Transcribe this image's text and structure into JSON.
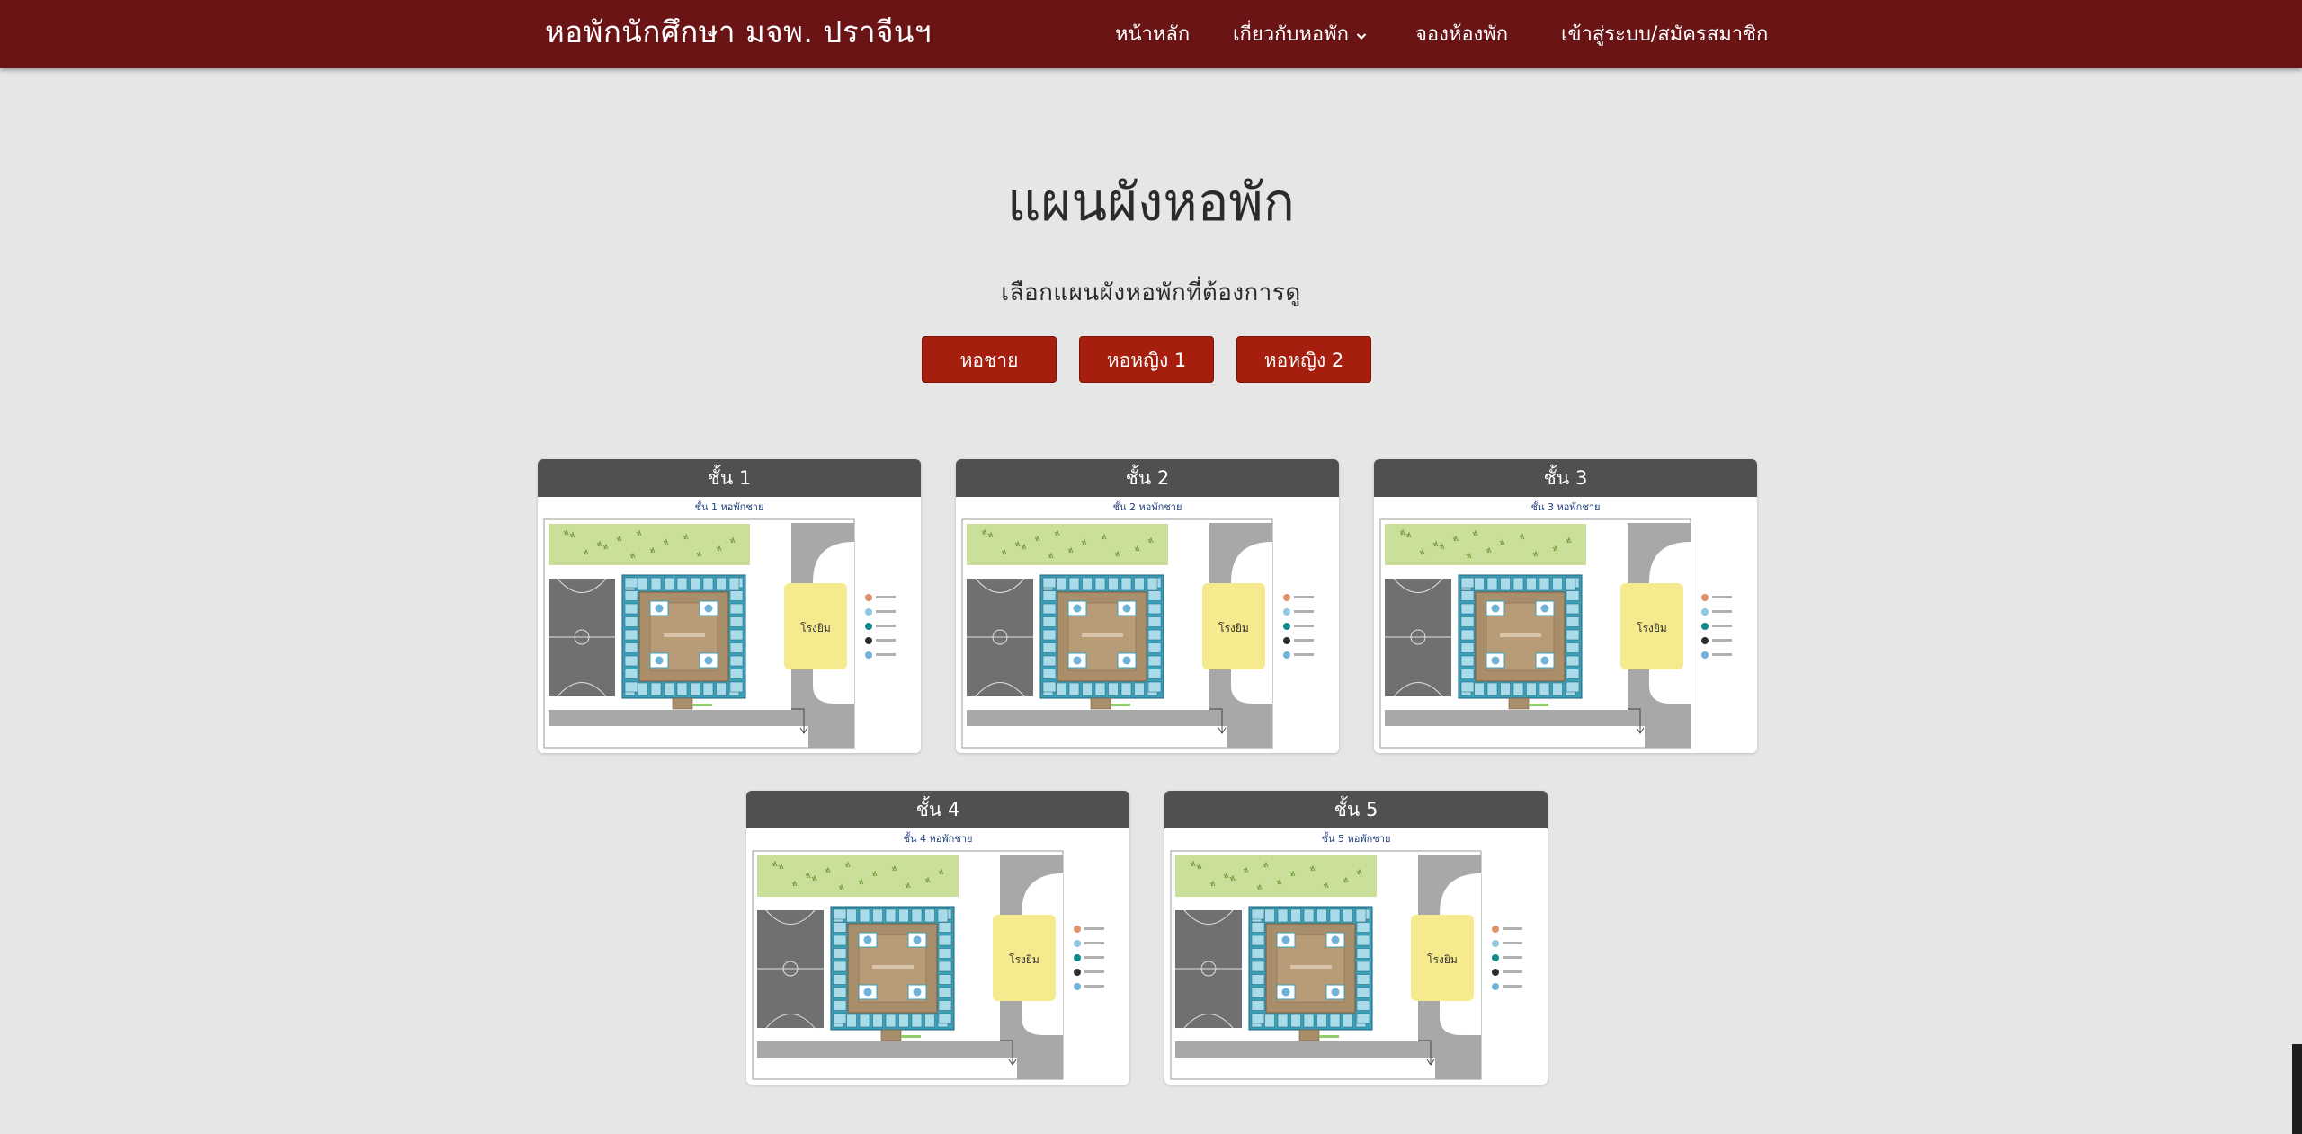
{
  "navbar": {
    "brand": "หอพักนักศึกษา มจพ. ปราจีนฯ",
    "links": [
      {
        "label": "หน้าหลัก"
      },
      {
        "label": "เกี่ยวกับหอพัก"
      },
      {
        "label": "จองห้องพัก"
      },
      {
        "label": "เข้าสู่ระบบ/สมัครสมาชิก"
      }
    ],
    "caret_icon": "chevron-down-icon"
  },
  "page": {
    "title": "แผนผังหอพัก",
    "subtitle": "เลือกแผนผังหอพักที่ต้องการดู"
  },
  "buttons": [
    {
      "label": "หอชาย"
    },
    {
      "label": "หอหญิง 1"
    },
    {
      "label": "หอหญิง 2"
    }
  ],
  "colors": {
    "navbar": "#6b1416",
    "button": "#a61e0d",
    "card_header": "#505050",
    "background": "#e6e6e6"
  },
  "floors": [
    {
      "header": "ชั้น 1",
      "plan_title": "ชั้น 1 หอพักชาย",
      "gym": "โรงยิม"
    },
    {
      "header": "ชั้น 2",
      "plan_title": "ชั้น 2 หอพักชาย",
      "gym": "โรงยิม"
    },
    {
      "header": "ชั้น 3",
      "plan_title": "ชั้น 3 หอพักชาย",
      "gym": "โรงยิม"
    },
    {
      "header": "ชั้น 4",
      "plan_title": "ชั้น 4 หอพักชาย",
      "gym": "โรงยิม"
    },
    {
      "header": "ชั้น 5",
      "plan_title": "ชั้น 5 หอพักชาย",
      "gym": "โรงยิม"
    }
  ]
}
